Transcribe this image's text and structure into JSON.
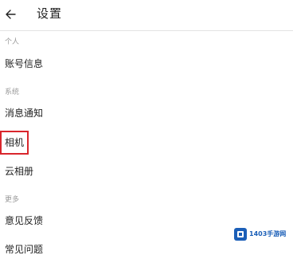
{
  "header": {
    "title": "设置"
  },
  "sections": {
    "personal": {
      "label": "个人",
      "items": [
        "账号信息"
      ]
    },
    "system": {
      "label": "系统",
      "items": [
        "消息通知",
        "相机",
        "云相册"
      ]
    },
    "more": {
      "label": "更多",
      "items": [
        "意见反馈",
        "常见问题"
      ]
    }
  },
  "highlight_color": "#d9262c",
  "watermark": {
    "text": "1403手游网"
  },
  "icons": {
    "back": "arrow-left-icon",
    "watermark": "logo-icon"
  }
}
